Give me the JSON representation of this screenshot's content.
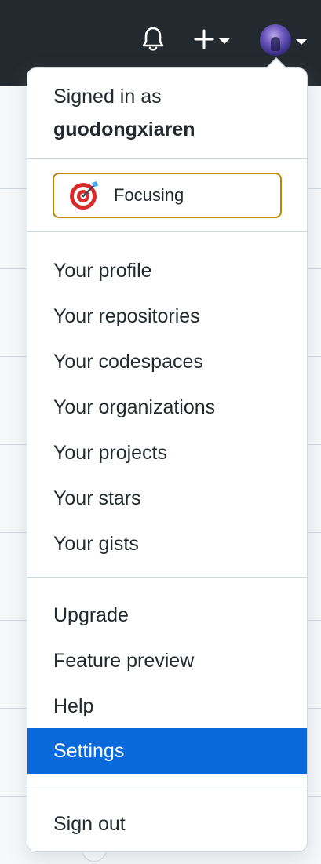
{
  "header": {
    "bell_icon": "bell-icon",
    "plus_icon": "plus-icon",
    "avatar_icon": "avatar"
  },
  "dropdown": {
    "signed_in_label": "Signed in as",
    "username": "guodongxiaren",
    "status": {
      "emoji": "direct-hit-target-icon",
      "label": "Focusing",
      "border_color": "#bf8700"
    },
    "profile_items": [
      {
        "label": "Your profile"
      },
      {
        "label": "Your repositories"
      },
      {
        "label": "Your codespaces"
      },
      {
        "label": "Your organizations"
      },
      {
        "label": "Your projects"
      },
      {
        "label": "Your stars"
      },
      {
        "label": "Your gists"
      }
    ],
    "misc_items": [
      {
        "label": "Upgrade"
      },
      {
        "label": "Feature preview"
      },
      {
        "label": "Help"
      },
      {
        "label": "Settings",
        "active": true
      }
    ],
    "sign_out_label": "Sign out"
  },
  "colors": {
    "header_bg": "#24292f",
    "active_bg": "#0969da",
    "text": "#24292f",
    "border": "#d0d7de"
  }
}
